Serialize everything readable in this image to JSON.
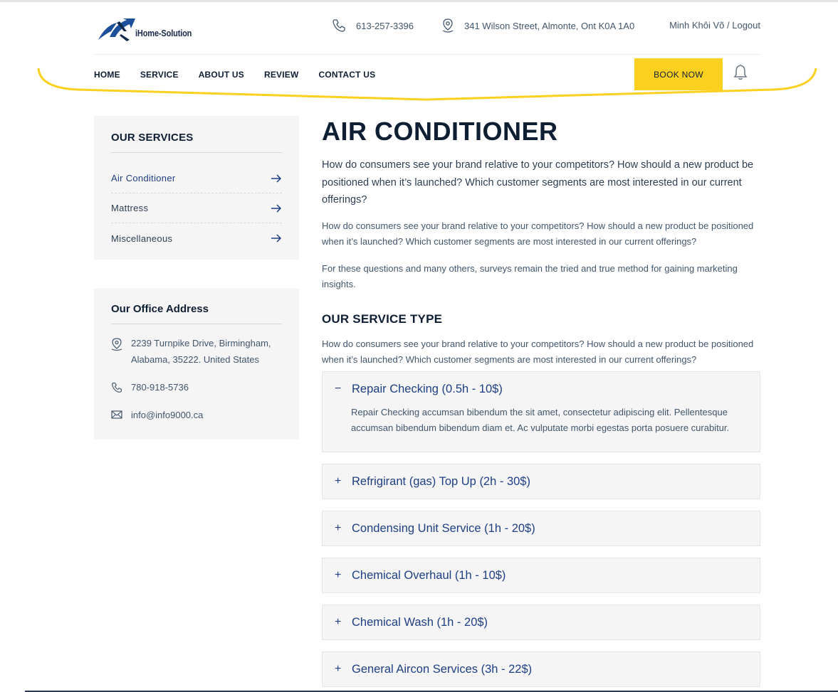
{
  "header": {
    "logo_text": "iHome-Solution",
    "phone": "613-257-3396",
    "address": "341 Wilson Street, Almonte, Ont K0A 1A0",
    "user": "Minh Khôi Võ / Logout"
  },
  "nav": {
    "items": [
      "HOME",
      "SERVICE",
      "ABOUT US",
      "REVIEW",
      "CONTACT US"
    ],
    "book_label": "BOOK NOW"
  },
  "sidebar": {
    "services_title": "OUR SERVICES",
    "services": [
      "Air Conditioner",
      "Mattress",
      "Miscellaneous"
    ],
    "office_title": "Our Office Address",
    "office_address": "2239 Turnpike Drive, Birmingham, Alabama, 35222. United States",
    "office_phone": "780-918-5736",
    "office_email": "info@info9000.ca"
  },
  "main": {
    "title": "AIR CONDITIONER",
    "lead": "How do consumers see your brand relative to your competitors? How should a new product be positioned when it’s launched? Which customer segments are most interested in our current offerings?",
    "para1": "How do consumers see your brand relative to your competitors? How should a new product be positioned when it’s launched? Which customer segments are most interested in our current offerings?",
    "para2": "For these questions and many others, surveys remain the tried and true method for gaining marketing insights.",
    "service_type_title": "OUR SERVICE TYPE",
    "para3": "How do consumers see your brand relative to your competitors? How should a new product be positioned when it’s launched? Which customer segments are most interested in our current offerings?"
  },
  "accordion": [
    {
      "sign": "−",
      "title": "Repair Checking (0.5h - 10$)",
      "body": "Repair Checking accumsan bibendum the sit amet, consectetur adipiscing elit. Pellentesque accumsan bibendum bibendum diam et. Ac vulputate morbi egestas porta posuere curabitur."
    },
    {
      "sign": "+",
      "title": "Refrigirant (gas) Top Up (2h - 30$)"
    },
    {
      "sign": "+",
      "title": "Condensing Unit Service (1h - 20$)"
    },
    {
      "sign": "+",
      "title": "Chemical Overhaul (1h - 10$)"
    },
    {
      "sign": "+",
      "title": "Chemical Wash (1h - 20$)"
    },
    {
      "sign": "+",
      "title": "General Aircon Services (3h - 22$)"
    }
  ],
  "colors": {
    "accent": "#fcd01f",
    "link": "#1e3f84",
    "dark": "#0e1e33"
  }
}
